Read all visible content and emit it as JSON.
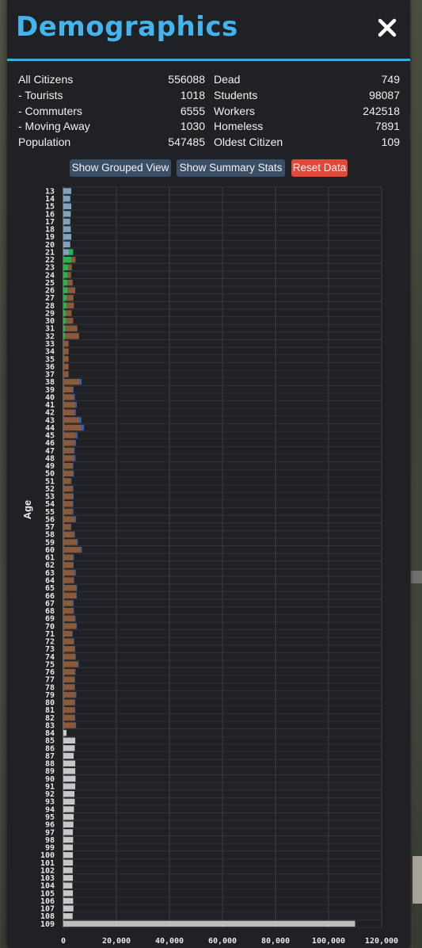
{
  "window": {
    "title": "Demographics",
    "close_icon": "close-icon"
  },
  "stats": {
    "left": [
      {
        "label": "All Citizens",
        "value": "556088"
      },
      {
        "label": "- Tourists",
        "value": "1018"
      },
      {
        "label": "- Commuters",
        "value": "6555"
      },
      {
        "label": "- Moving Away",
        "value": "1030"
      },
      {
        "label": "Population",
        "value": "547485"
      }
    ],
    "right": [
      {
        "label": "Dead",
        "value": "749"
      },
      {
        "label": "Students",
        "value": "98087"
      },
      {
        "label": "Workers",
        "value": "242518"
      },
      {
        "label": "Homeless",
        "value": "7891"
      },
      {
        "label": "Oldest Citizen",
        "value": "109"
      }
    ]
  },
  "buttons": {
    "grouped": "Show Grouped View",
    "summary": "Show Summary Stats",
    "reset": "Reset Data"
  },
  "colors": {
    "accent": "#43b5ec",
    "panel": "#1f2124",
    "button": "#3a4e66",
    "reset": "#e0483a",
    "child": "#7fa2bd",
    "student": "#22b84a",
    "worker": "#8a5a3c",
    "worker_tag": "#2f5fbf",
    "retired": "#c8c8c8",
    "oldest": "#bdbdbd"
  },
  "chart_data": {
    "type": "bar",
    "orientation": "horizontal",
    "ylabel": "Age",
    "xlabel": "",
    "xlim": [
      0,
      120000
    ],
    "x_ticks": [
      "0",
      "20,000",
      "40,000",
      "60,000",
      "80,000",
      "100,000",
      "120,000"
    ],
    "categories": [
      "13",
      "14",
      "15",
      "16",
      "17",
      "18",
      "19",
      "20",
      "21",
      "22",
      "23",
      "24",
      "25",
      "26",
      "27",
      "28",
      "29",
      "30",
      "31",
      "32",
      "33",
      "34",
      "35",
      "36",
      "37",
      "38",
      "39",
      "40",
      "41",
      "42",
      "43",
      "44",
      "45",
      "46",
      "47",
      "48",
      "49",
      "50",
      "51",
      "52",
      "53",
      "54",
      "55",
      "56",
      "57",
      "58",
      "59",
      "60",
      "61",
      "62",
      "63",
      "64",
      "65",
      "66",
      "67",
      "68",
      "69",
      "70",
      "71",
      "72",
      "73",
      "74",
      "75",
      "76",
      "77",
      "78",
      "79",
      "80",
      "81",
      "82",
      "83",
      "84",
      "85",
      "86",
      "87",
      "88",
      "89",
      "90",
      "91",
      "92",
      "93",
      "94",
      "95",
      "96",
      "97",
      "98",
      "99",
      "100",
      "101",
      "102",
      "103",
      "104",
      "105",
      "106",
      "107",
      "108",
      "109"
    ],
    "series": [
      {
        "key": "child",
        "values": [
          3000,
          2600,
          3000,
          2800,
          2600,
          2800,
          3000,
          2600,
          2200,
          0,
          0,
          0,
          0,
          0,
          0,
          0,
          0,
          0,
          0,
          0,
          0,
          0,
          0,
          0,
          0,
          0,
          0,
          0,
          0,
          0,
          0,
          0,
          0,
          0,
          0,
          0,
          0,
          0,
          0,
          0,
          0,
          0,
          0,
          0,
          0,
          0,
          0,
          0,
          0,
          0,
          0,
          0,
          0,
          0,
          0,
          0,
          0,
          0,
          0,
          0,
          0,
          0,
          0,
          0,
          0,
          0,
          0,
          0,
          0,
          0,
          0,
          0,
          0,
          0,
          0,
          0,
          0,
          0,
          0,
          0,
          0,
          0,
          0,
          0,
          0,
          0,
          0,
          0,
          0,
          0,
          0,
          0,
          0,
          0,
          0,
          0,
          0
        ]
      },
      {
        "key": "student",
        "values": [
          0,
          0,
          0,
          0,
          0,
          0,
          0,
          0,
          1500,
          3000,
          1800,
          1500,
          1500,
          1500,
          1200,
          1200,
          900,
          900,
          700,
          600,
          0,
          0,
          0,
          0,
          0,
          0,
          0,
          0,
          0,
          0,
          0,
          0,
          0,
          0,
          0,
          0,
          0,
          0,
          0,
          0,
          0,
          0,
          0,
          0,
          0,
          0,
          0,
          0,
          0,
          0,
          0,
          0,
          0,
          0,
          0,
          0,
          0,
          0,
          0,
          0,
          0,
          0,
          0,
          0,
          0,
          0,
          0,
          0,
          0,
          0,
          0,
          0,
          0,
          0,
          0,
          0,
          0,
          0,
          0,
          0,
          0,
          0,
          0,
          0,
          0,
          0,
          0,
          0,
          0,
          0,
          0,
          0,
          0,
          0,
          0,
          0,
          0
        ]
      },
      {
        "key": "worker",
        "values": [
          0,
          0,
          0,
          0,
          0,
          0,
          0,
          0,
          0,
          1600,
          1400,
          1400,
          2000,
          3000,
          2600,
          2800,
          2200,
          2800,
          4600,
          5300,
          2000,
          2000,
          2000,
          2000,
          2000,
          6200,
          3600,
          4000,
          4600,
          4300,
          6000,
          6800,
          4700,
          4300,
          3900,
          4100,
          3500,
          3700,
          2900,
          3500,
          3600,
          3500,
          3500,
          4400,
          2800,
          4100,
          5100,
          6600,
          3700,
          3700,
          4400,
          3900,
          4900,
          4800,
          3500,
          3800,
          4300,
          4800,
          3300,
          3900,
          4300,
          4500,
          5500,
          4400,
          4200,
          4200,
          4600,
          4300,
          4300,
          4300,
          4600,
          0,
          0,
          0,
          0,
          0,
          0,
          0,
          0,
          0,
          0,
          0,
          0,
          0,
          0,
          0,
          0,
          0,
          0,
          0,
          0,
          0,
          0,
          0,
          0,
          0,
          0
        ]
      },
      {
        "key": "worker_tag",
        "values": [
          0,
          0,
          0,
          0,
          0,
          0,
          0,
          0,
          0,
          0,
          0,
          0,
          0,
          0,
          0,
          0,
          0,
          0,
          0,
          0,
          0,
          0,
          0,
          0,
          0,
          700,
          300,
          400,
          500,
          400,
          800,
          1000,
          700,
          500,
          400,
          500,
          300,
          300,
          200,
          300,
          300,
          300,
          300,
          400,
          200,
          300,
          400,
          400,
          300,
          200,
          300,
          200,
          300,
          300,
          400,
          200,
          300,
          300,
          200,
          200,
          200,
          200,
          300,
          200,
          200,
          200,
          300,
          200,
          200,
          200,
          200,
          0,
          0,
          0,
          0,
          0,
          0,
          0,
          0,
          0,
          0,
          0,
          0,
          0,
          0,
          0,
          0,
          0,
          0,
          0,
          0,
          0,
          0,
          0,
          0,
          0,
          0
        ]
      },
      {
        "key": "retired",
        "values": [
          0,
          0,
          0,
          0,
          0,
          0,
          0,
          0,
          0,
          0,
          0,
          0,
          0,
          0,
          0,
          0,
          0,
          0,
          0,
          0,
          0,
          0,
          0,
          0,
          0,
          0,
          0,
          0,
          0,
          0,
          0,
          0,
          0,
          0,
          0,
          0,
          0,
          0,
          0,
          0,
          0,
          0,
          0,
          0,
          0,
          0,
          0,
          0,
          0,
          0,
          0,
          0,
          0,
          0,
          0,
          0,
          0,
          0,
          0,
          0,
          0,
          0,
          0,
          0,
          0,
          0,
          0,
          0,
          0,
          0,
          0,
          1200,
          4500,
          4300,
          3900,
          4500,
          4500,
          4600,
          4500,
          4200,
          4300,
          4000,
          3900,
          3800,
          3600,
          3700,
          3600,
          3600,
          3600,
          3500,
          3600,
          3400,
          3600,
          3700,
          3800,
          3500,
          110000
        ]
      }
    ]
  }
}
